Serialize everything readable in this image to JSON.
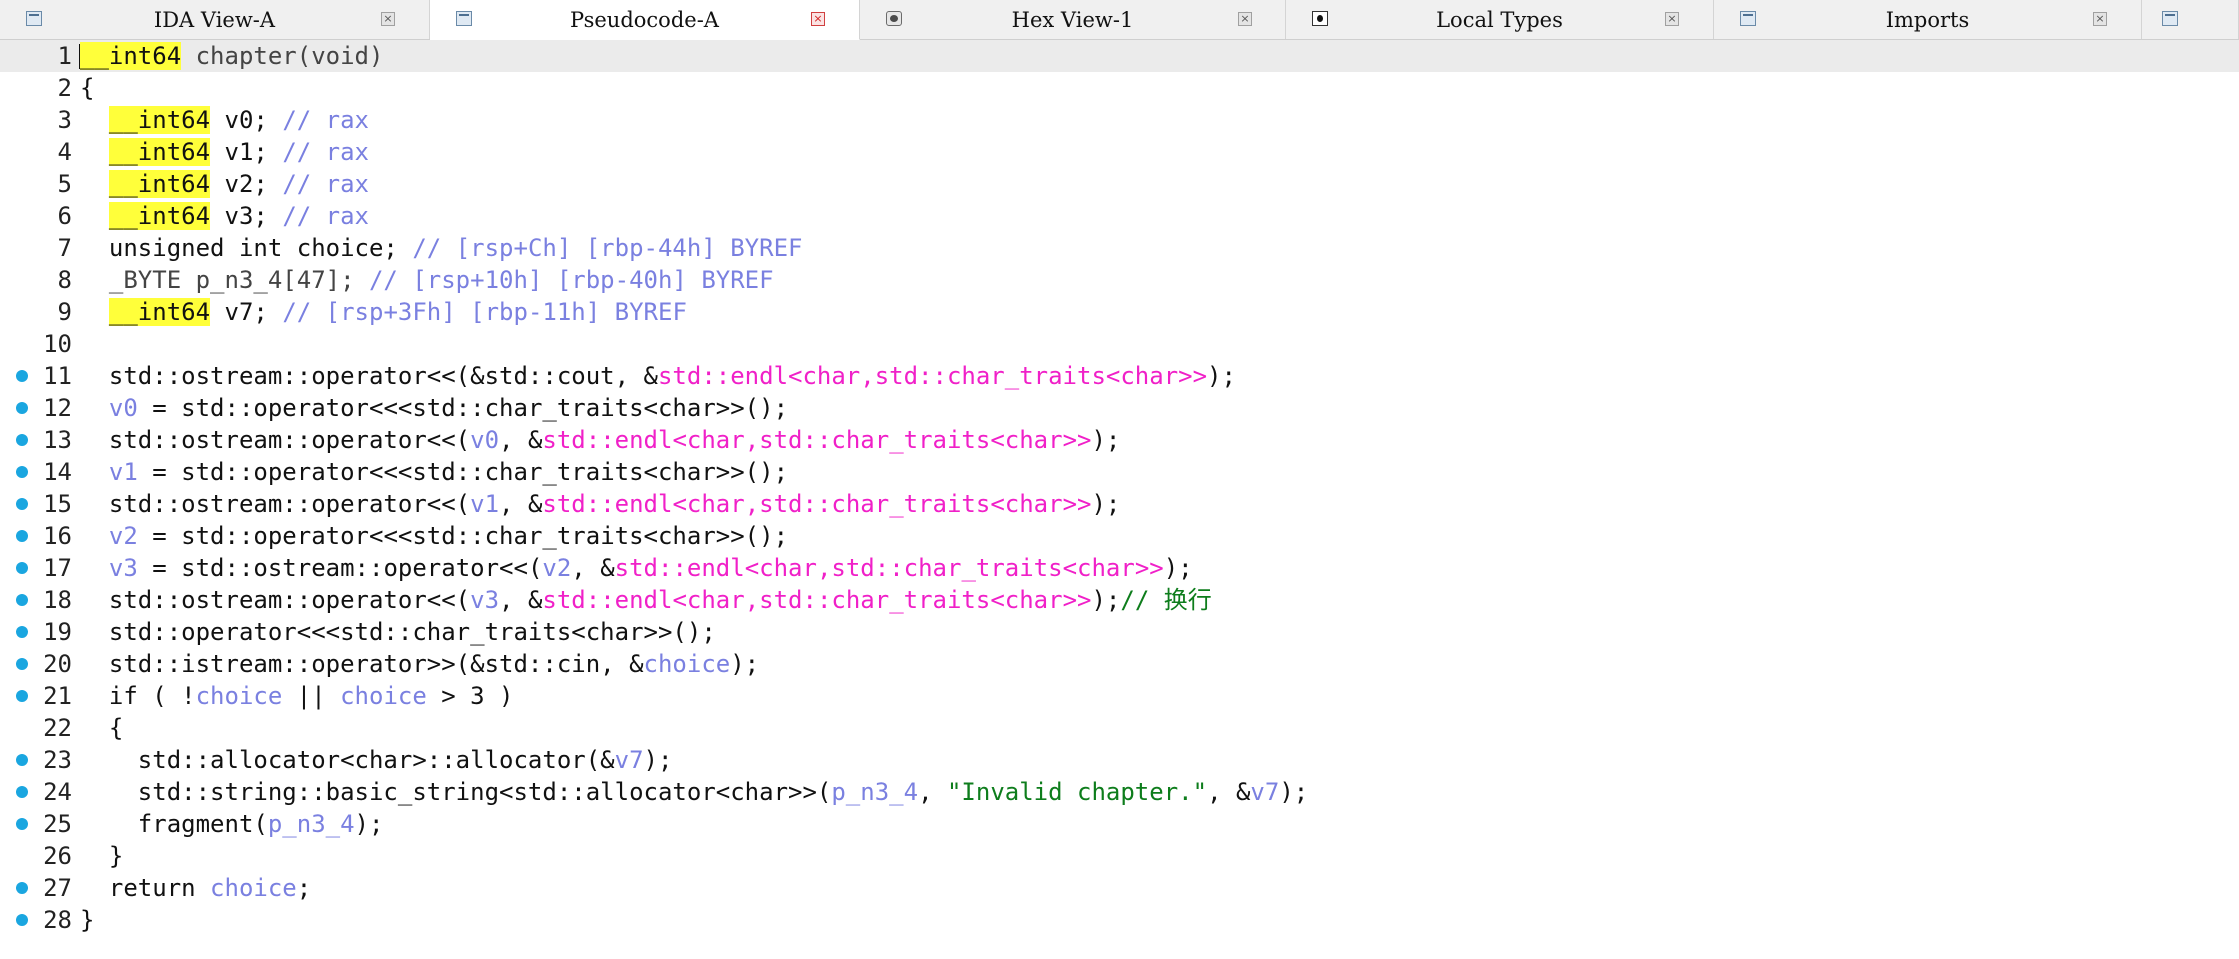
{
  "tabs": [
    {
      "label": "IDA View-A",
      "icon": "ida-view-icon",
      "active": false
    },
    {
      "label": "Pseudocode-A",
      "icon": "pseudocode-icon",
      "active": true
    },
    {
      "label": "Hex View-1",
      "icon": "hex-view-icon",
      "active": false
    },
    {
      "label": "Local Types",
      "icon": "local-types-icon",
      "active": false
    },
    {
      "label": "Imports",
      "icon": "imports-icon",
      "active": false
    },
    {
      "label": "",
      "icon": "extra-view-icon",
      "active": false
    }
  ],
  "colors": {
    "keyword_highlight": "#ffff3a",
    "comment": "#7a80e0",
    "variable": "#7a80e0",
    "library_function": "#f020c8",
    "string": "#0e7d1c",
    "breakpoint_dot": "#1aa6e0",
    "active_tab_close": "#d02020"
  },
  "code_lines": [
    {
      "num": "1",
      "dot": false,
      "segments": [
        {
          "t": "__int64",
          "c": "kw"
        },
        {
          "t": " chapter(void)",
          "c": "dim"
        }
      ]
    },
    {
      "num": "2",
      "dot": false,
      "segments": [
        {
          "t": "{",
          "c": ""
        }
      ]
    },
    {
      "num": "3",
      "dot": false,
      "segments": [
        {
          "t": "  ",
          "c": ""
        },
        {
          "t": "__int64",
          "c": "kw"
        },
        {
          "t": " v0; ",
          "c": ""
        },
        {
          "t": "// rax",
          "c": "cm"
        }
      ]
    },
    {
      "num": "4",
      "dot": false,
      "segments": [
        {
          "t": "  ",
          "c": ""
        },
        {
          "t": "__int64",
          "c": "kw"
        },
        {
          "t": " v1; ",
          "c": ""
        },
        {
          "t": "// rax",
          "c": "cm"
        }
      ]
    },
    {
      "num": "5",
      "dot": false,
      "segments": [
        {
          "t": "  ",
          "c": ""
        },
        {
          "t": "__int64",
          "c": "kw"
        },
        {
          "t": " v2; ",
          "c": ""
        },
        {
          "t": "// rax",
          "c": "cm"
        }
      ]
    },
    {
      "num": "6",
      "dot": false,
      "segments": [
        {
          "t": "  ",
          "c": ""
        },
        {
          "t": "__int64",
          "c": "kw"
        },
        {
          "t": " v3; ",
          "c": ""
        },
        {
          "t": "// rax",
          "c": "cm"
        }
      ]
    },
    {
      "num": "7",
      "dot": false,
      "segments": [
        {
          "t": "  unsigned int choice; ",
          "c": ""
        },
        {
          "t": "// [rsp+Ch] [rbp-44h] BYREF",
          "c": "cm"
        }
      ]
    },
    {
      "num": "8",
      "dot": false,
      "segments": [
        {
          "t": "  _BYTE p_n3_4[47]; ",
          "c": "dim"
        },
        {
          "t": "// [rsp+10h] [rbp-40h] BYREF",
          "c": "cm"
        }
      ]
    },
    {
      "num": "9",
      "dot": false,
      "segments": [
        {
          "t": "  ",
          "c": ""
        },
        {
          "t": "__int64",
          "c": "kw"
        },
        {
          "t": " v7; ",
          "c": ""
        },
        {
          "t": "// [rsp+3Fh] [rbp-11h] BYREF",
          "c": "cm"
        }
      ]
    },
    {
      "num": "10",
      "dot": false,
      "segments": [
        {
          "t": "",
          "c": ""
        }
      ]
    },
    {
      "num": "11",
      "dot": true,
      "segments": [
        {
          "t": "  std::ostream::operator<<(&std::cout, &",
          "c": ""
        },
        {
          "t": "std::endl<char,std::char_traits<char>>",
          "c": "fn"
        },
        {
          "t": ");",
          "c": ""
        }
      ]
    },
    {
      "num": "12",
      "dot": true,
      "segments": [
        {
          "t": "  ",
          "c": ""
        },
        {
          "t": "v0",
          "c": "vr"
        },
        {
          "t": " = std::operator<<<std::char_traits<char>>();",
          "c": ""
        }
      ]
    },
    {
      "num": "13",
      "dot": true,
      "segments": [
        {
          "t": "  std::ostream::operator<<(",
          "c": ""
        },
        {
          "t": "v0",
          "c": "vr"
        },
        {
          "t": ", &",
          "c": ""
        },
        {
          "t": "std::endl<char,std::char_traits<char>>",
          "c": "fn"
        },
        {
          "t": ");",
          "c": ""
        }
      ]
    },
    {
      "num": "14",
      "dot": true,
      "segments": [
        {
          "t": "  ",
          "c": ""
        },
        {
          "t": "v1",
          "c": "vr"
        },
        {
          "t": " = std::operator<<<std::char_traits<char>>();",
          "c": ""
        }
      ]
    },
    {
      "num": "15",
      "dot": true,
      "segments": [
        {
          "t": "  std::ostream::operator<<(",
          "c": ""
        },
        {
          "t": "v1",
          "c": "vr"
        },
        {
          "t": ", &",
          "c": ""
        },
        {
          "t": "std::endl<char,std::char_traits<char>>",
          "c": "fn"
        },
        {
          "t": ");",
          "c": ""
        }
      ]
    },
    {
      "num": "16",
      "dot": true,
      "segments": [
        {
          "t": "  ",
          "c": ""
        },
        {
          "t": "v2",
          "c": "vr"
        },
        {
          "t": " = std::operator<<<std::char_traits<char>>();",
          "c": ""
        }
      ]
    },
    {
      "num": "17",
      "dot": true,
      "segments": [
        {
          "t": "  ",
          "c": ""
        },
        {
          "t": "v3",
          "c": "vr"
        },
        {
          "t": " = std::ostream::operator<<(",
          "c": ""
        },
        {
          "t": "v2",
          "c": "vr"
        },
        {
          "t": ", &",
          "c": ""
        },
        {
          "t": "std::endl<char,std::char_traits<char>>",
          "c": "fn"
        },
        {
          "t": ");",
          "c": ""
        }
      ]
    },
    {
      "num": "18",
      "dot": true,
      "segments": [
        {
          "t": "  std::ostream::operator<<(",
          "c": ""
        },
        {
          "t": "v3",
          "c": "vr"
        },
        {
          "t": ", &",
          "c": ""
        },
        {
          "t": "std::endl<char,std::char_traits<char>>",
          "c": "fn"
        },
        {
          "t": ");",
          "c": ""
        },
        {
          "t": "// 换行",
          "c": "st"
        }
      ]
    },
    {
      "num": "19",
      "dot": true,
      "segments": [
        {
          "t": "  std::operator<<<std::char_traits<char>>();",
          "c": ""
        }
      ]
    },
    {
      "num": "20",
      "dot": true,
      "segments": [
        {
          "t": "  std::istream::operator>>(&std::cin, &",
          "c": ""
        },
        {
          "t": "choice",
          "c": "vr"
        },
        {
          "t": ");",
          "c": ""
        }
      ]
    },
    {
      "num": "21",
      "dot": true,
      "segments": [
        {
          "t": "  if ( !",
          "c": ""
        },
        {
          "t": "choice",
          "c": "vr"
        },
        {
          "t": " || ",
          "c": ""
        },
        {
          "t": "choice",
          "c": "vr"
        },
        {
          "t": " > 3 )",
          "c": ""
        }
      ]
    },
    {
      "num": "22",
      "dot": false,
      "segments": [
        {
          "t": "  {",
          "c": ""
        }
      ]
    },
    {
      "num": "23",
      "dot": true,
      "segments": [
        {
          "t": "    std::allocator<char>::allocator(&",
          "c": ""
        },
        {
          "t": "v7",
          "c": "vr"
        },
        {
          "t": ");",
          "c": ""
        }
      ]
    },
    {
      "num": "24",
      "dot": true,
      "segments": [
        {
          "t": "    std::string::basic_string<std::allocator<char>>(",
          "c": ""
        },
        {
          "t": "p_n3_4",
          "c": "vr"
        },
        {
          "t": ", ",
          "c": ""
        },
        {
          "t": "\"Invalid chapter.\"",
          "c": "st"
        },
        {
          "t": ", &",
          "c": ""
        },
        {
          "t": "v7",
          "c": "vr"
        },
        {
          "t": ");",
          "c": ""
        }
      ]
    },
    {
      "num": "25",
      "dot": true,
      "segments": [
        {
          "t": "    fragment(",
          "c": ""
        },
        {
          "t": "p_n3_4",
          "c": "vr"
        },
        {
          "t": ");",
          "c": ""
        }
      ]
    },
    {
      "num": "26",
      "dot": false,
      "segments": [
        {
          "t": "  }",
          "c": ""
        }
      ]
    },
    {
      "num": "27",
      "dot": true,
      "segments": [
        {
          "t": "  return ",
          "c": ""
        },
        {
          "t": "choice",
          "c": "vr"
        },
        {
          "t": ";",
          "c": ""
        }
      ]
    },
    {
      "num": "28",
      "dot": true,
      "segments": [
        {
          "t": "}",
          "c": ""
        }
      ]
    }
  ]
}
